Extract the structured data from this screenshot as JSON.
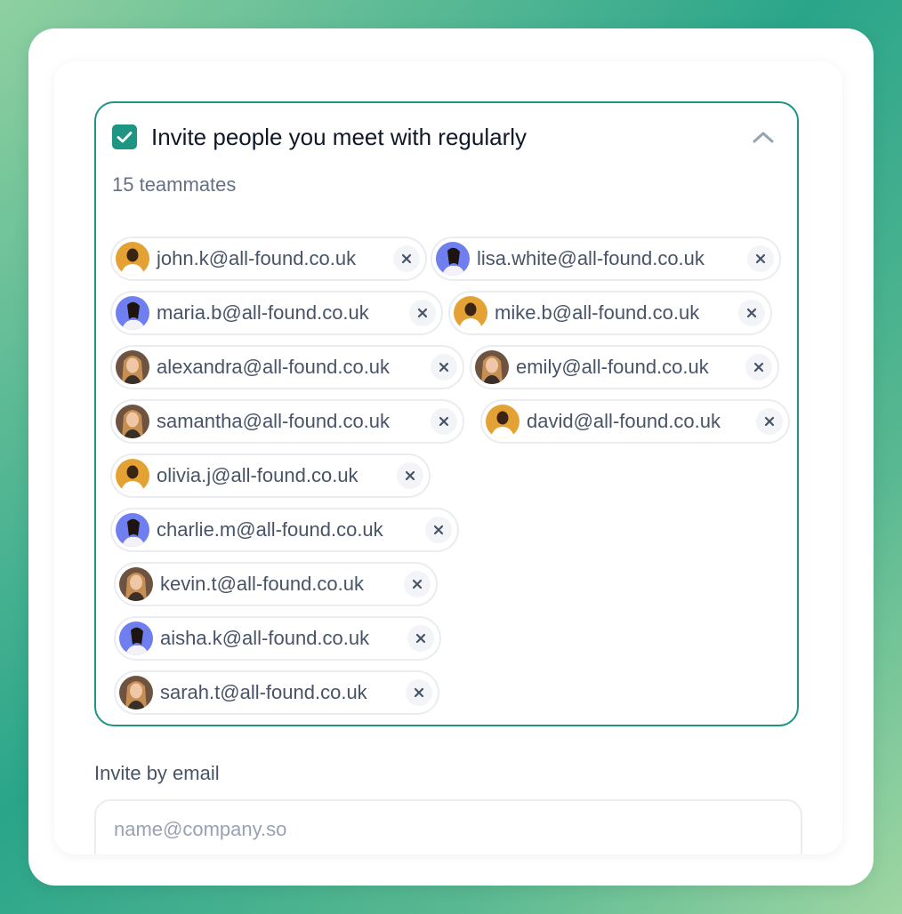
{
  "panel": {
    "title": "Invite people you meet with regularly",
    "subtitle": "15 teammates",
    "checked": true
  },
  "invitees": [
    {
      "email": "john.k@all-found.co.uk",
      "avatar": "orange"
    },
    {
      "email": "lisa.white@all-found.co.uk",
      "avatar": "blue"
    },
    {
      "email": "maria.b@all-found.co.uk",
      "avatar": "blue"
    },
    {
      "email": "mike.b@all-found.co.uk",
      "avatar": "orange"
    },
    {
      "email": "alexandra@all-found.co.uk",
      "avatar": "brown"
    },
    {
      "email": "emily@all-found.co.uk",
      "avatar": "brown"
    },
    {
      "email": "samantha@all-found.co.uk",
      "avatar": "brown"
    },
    {
      "email": "david@all-found.co.uk",
      "avatar": "orange"
    },
    {
      "email": "olivia.j@all-found.co.uk",
      "avatar": "orange"
    },
    {
      "email": "charlie.m@all-found.co.uk",
      "avatar": "blue"
    },
    {
      "email": "kevin.t@all-found.co.uk",
      "avatar": "brown"
    },
    {
      "email": "aisha.k@all-found.co.uk",
      "avatar": "blue"
    },
    {
      "email": "sarah.t@all-found.co.uk",
      "avatar": "brown"
    }
  ],
  "invite_by_email": {
    "label": "Invite by email",
    "placeholder": "name@company.so",
    "value": ""
  },
  "colors": {
    "accent": "#1f9583",
    "avatar_orange": "#e3a233",
    "avatar_blue": "#6f7ff0",
    "avatar_brown": "#6e5340"
  },
  "icons": {
    "checkbox": "check-icon",
    "collapse": "chevron-up-icon",
    "remove": "close-icon"
  }
}
